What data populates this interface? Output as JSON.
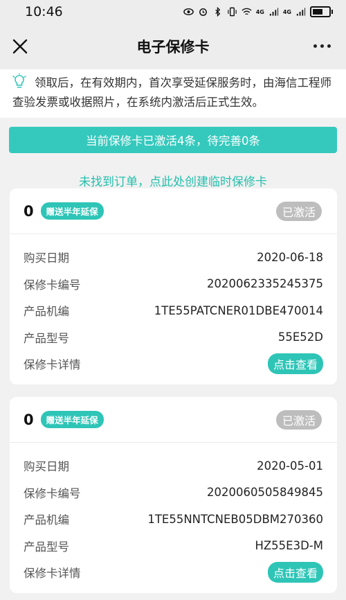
{
  "status_bar": {
    "time": "10:46",
    "signal_label_1": "4G",
    "signal_label_2": "4G"
  },
  "header": {
    "title": "电子保修卡",
    "close_icon": "close-icon",
    "more_icon": "more-icon"
  },
  "notice": {
    "icon": "lightbulb-icon",
    "text": "领取后，在有效期内，首次享受延保服务时，由海信工程师查验发票或收据照片，在系统内激活后正式生效。"
  },
  "summary_banner": "当前保修卡已激活4条，待完善0条",
  "create_link": "未找到订单，点此处创建临时保修卡",
  "colors": {
    "accent": "#35c9bd",
    "link": "#25bfae",
    "activated_badge": "#bdbdbd"
  },
  "cards": [
    {
      "count": "0",
      "promo": "赠送半年延保",
      "status": "已激活",
      "rows": [
        {
          "label": "购买日期",
          "value": "2020-06-18"
        },
        {
          "label": "保修卡编号",
          "value": "2020062335245375"
        },
        {
          "label": "产品机编",
          "value": "1TE55PATCNER01DBE470014"
        },
        {
          "label": "产品型号",
          "value": "55E52D"
        }
      ],
      "detail_label": "保修卡详情",
      "detail_button": "点击查看"
    },
    {
      "count": "0",
      "promo": "赠送半年延保",
      "status": "已激活",
      "rows": [
        {
          "label": "购买日期",
          "value": "2020-05-01"
        },
        {
          "label": "保修卡编号",
          "value": "2020060505849845"
        },
        {
          "label": "产品机编",
          "value": "1TE55NNTCNEB05DBM270360"
        },
        {
          "label": "产品型号",
          "value": "HZ55E3D-M"
        }
      ],
      "detail_label": "保修卡详情",
      "detail_button": "点击查看"
    }
  ]
}
